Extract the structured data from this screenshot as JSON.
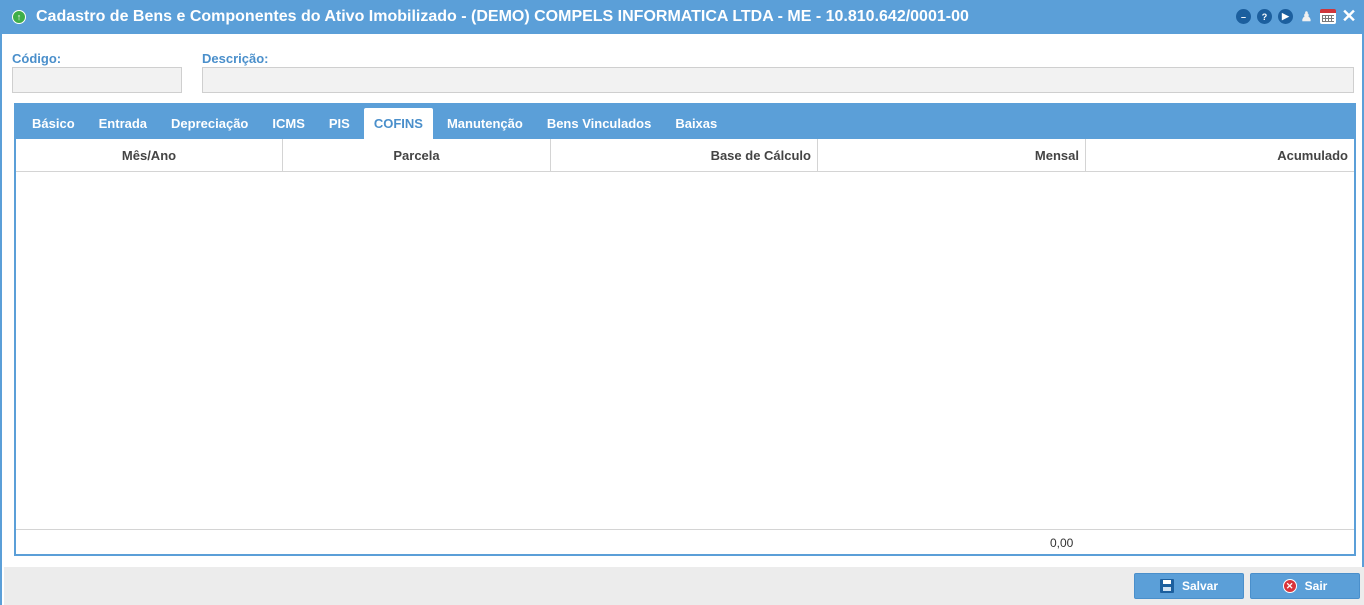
{
  "window": {
    "title": "Cadastro de Bens e Componentes do Ativo Imobilizado - (DEMO) COMPELS INFORMATICA LTDA - ME - 10.810.642/0001-00"
  },
  "title_controls": {
    "icons": [
      "minimize-icon",
      "help-icon",
      "forward-icon",
      "bell-icon",
      "calendar-icon",
      "close-icon"
    ],
    "close_glyph": "✕"
  },
  "form": {
    "codigo": {
      "label": "Código:",
      "value": ""
    },
    "descricao": {
      "label": "Descrição:",
      "value": ""
    }
  },
  "tabs": [
    {
      "label": "Básico",
      "active": false
    },
    {
      "label": "Entrada",
      "active": false
    },
    {
      "label": "Depreciação",
      "active": false
    },
    {
      "label": "ICMS",
      "active": false
    },
    {
      "label": "PIS",
      "active": false
    },
    {
      "label": "COFINS",
      "active": true
    },
    {
      "label": "Manutenção",
      "active": false
    },
    {
      "label": "Bens Vinculados",
      "active": false
    },
    {
      "label": "Baixas",
      "active": false
    }
  ],
  "grid": {
    "columns": [
      "Mês/Ano",
      "Parcela",
      "Base de Cálculo",
      "Mensal",
      "Acumulado"
    ],
    "rows": [],
    "footer_total": "0,00"
  },
  "buttons": {
    "save_label": "Salvar",
    "exit_label": "Sair"
  },
  "colors": {
    "accent": "#5b9fd8",
    "label": "#4a8fcb",
    "danger": "#d9343a"
  }
}
